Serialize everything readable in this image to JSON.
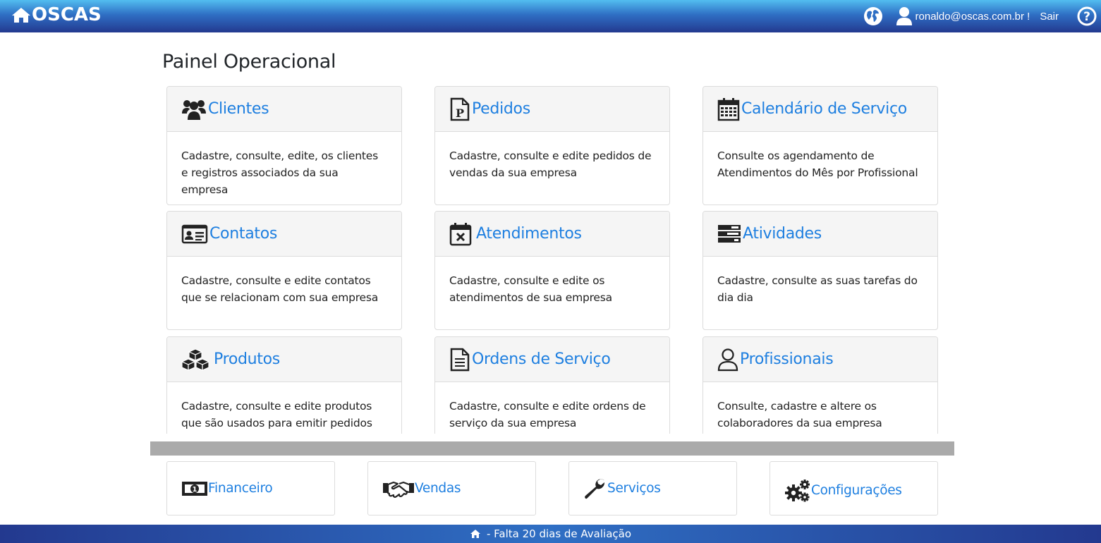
{
  "header": {
    "brand": "OSCAS",
    "user_email": "ronaldo@oscas.com.br !",
    "logout_label": "Sair"
  },
  "page": {
    "title": "Painel Operacional"
  },
  "cards": [
    {
      "title": "Clientes",
      "icon": "users-icon",
      "description": "Cadastre, consulte, edite, os clientes e registros associados da sua empresa"
    },
    {
      "title": "Pedidos",
      "icon": "order-document-icon",
      "description": "Cadastre, consulte e edite pedidos de vendas da sua empresa"
    },
    {
      "title": "Calendário de Serviço",
      "icon": "calendar-icon",
      "description": "Consulte os agendamento de Atendimentos do Mês por Profissional"
    },
    {
      "title": "Contatos",
      "icon": "contact-card-icon",
      "description": "Cadastre, consulte e edite contatos que se relacionam com sua empresa"
    },
    {
      "title": "Atendimentos",
      "icon": "calendar-x-icon",
      "description": "Cadastre, consulte e edite os atendimentos de sua empresa"
    },
    {
      "title": "Atividades",
      "icon": "tasks-icon",
      "description": "Cadastre, consulte as suas tarefas do dia dia"
    },
    {
      "title": "Produtos",
      "icon": "cubes-icon",
      "description": "Cadastre, consulte e edite produtos que são usados para emitir pedidos"
    },
    {
      "title": "Ordens de Serviço",
      "icon": "file-text-icon",
      "description": "Cadastre, consulte e edite ordens de serviço da sua empresa"
    },
    {
      "title": "Profissionais",
      "icon": "user-outline-icon",
      "description": "Consulte, cadastre e altere os colaboradores da sua empresa"
    }
  ],
  "modules": [
    {
      "label": "Financeiro",
      "icon": "money-bill-icon"
    },
    {
      "label": "Vendas",
      "icon": "handshake-icon"
    },
    {
      "label": "Serviços",
      "icon": "wrench-icon"
    },
    {
      "label": "Configurações",
      "icon": "gears-icon"
    }
  ],
  "footer": {
    "text": " - Falta 20 dias de Avaliação"
  },
  "colors": {
    "accent": "#1e7fe0",
    "header_top": "#52bdf0",
    "header_bottom": "#23398f",
    "divider": "#aaaaaa"
  }
}
